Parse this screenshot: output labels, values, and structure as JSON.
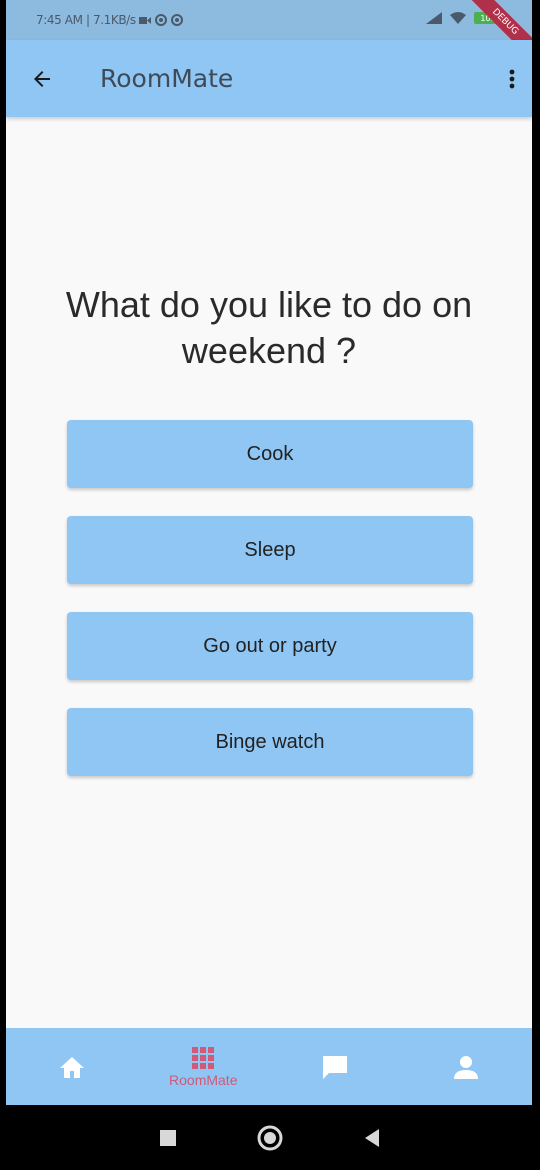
{
  "status_bar": {
    "text": "7:45 AM | 7.1KB/s",
    "battery": "100"
  },
  "debug_banner": "DEBUG",
  "app_bar": {
    "title": "RoomMate"
  },
  "question": {
    "line1": "What do you like to do on",
    "line2": "weekend ?"
  },
  "options": [
    {
      "label": "Cook"
    },
    {
      "label": "Sleep"
    },
    {
      "label": "Go out or party"
    },
    {
      "label": "Binge watch"
    }
  ],
  "bottom_nav": {
    "items": [
      {
        "icon": "home-icon",
        "label": ""
      },
      {
        "icon": "grid-icon",
        "label": "RoomMate"
      },
      {
        "icon": "chat-icon",
        "label": ""
      },
      {
        "icon": "person-icon",
        "label": ""
      }
    ],
    "active_color": "#d05a78"
  },
  "colors": {
    "primary": "#90c6f3",
    "background": "#f9f9f9"
  }
}
